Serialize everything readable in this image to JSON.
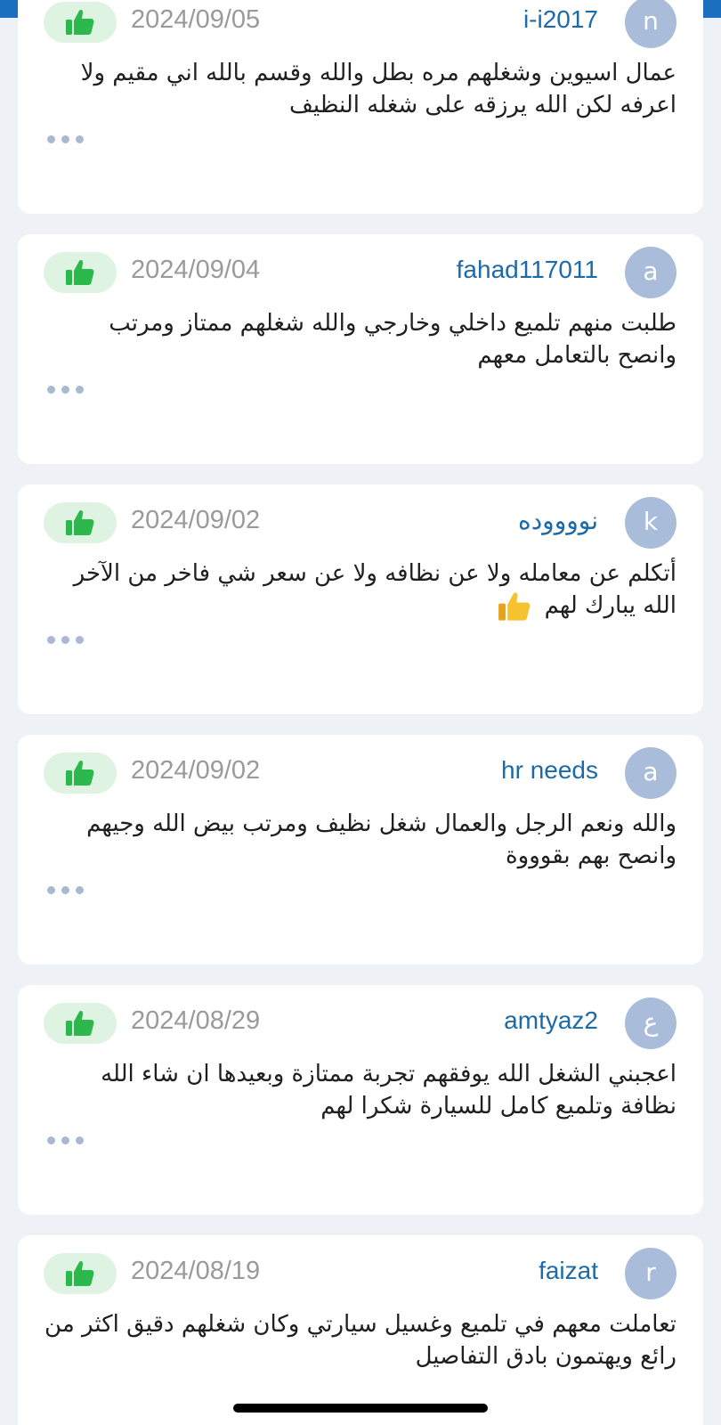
{
  "reviews": [
    {
      "avatar": "n",
      "username": "i-i2017",
      "date": "2024/09/05",
      "text": "عمال اسيوين وشغلهم مره بطل والله وقسم بالله اني مقيم ولا اعرفه لكن الله يرزقه على شغله النظيف"
    },
    {
      "avatar": "a",
      "username": "fahad117011",
      "date": "2024/09/04",
      "text": "طلبت منهم تلميع داخلي وخارجي  والله شغلهم ممتاز ومرتب وانصح بالتعامل معهم"
    },
    {
      "avatar": "k",
      "username": "نووووده",
      "date": "2024/09/02",
      "text": "أتكلم عن معامله ولا عن نظافه ولا عن سعر شي فاخر من الآخر الله يبارك لهم"
    },
    {
      "avatar": "a",
      "username": "hr needs",
      "date": "2024/09/02",
      "text": "والله ونعم الرجل والعمال شغل نظيف ومرتب بيض الله وجيهم وانصح بهم بقوووة"
    },
    {
      "avatar": "ع",
      "username": "amtyaz2",
      "date": "2024/08/29",
      "text": "اعجبني الشغل الله يوفقهم تجربة ممتازة وبعيدها ان شاء الله نظافة وتلميع كامل للسيارة شكرا لهم"
    },
    {
      "avatar": "r",
      "username": "faizat",
      "date": "2024/08/19",
      "text": "تعاملت معهم في تلميع  وغسيل  سيارتي  وكان شغلهم دقيق اكثر من رائع   ويهتمون  بادق التفاصيل"
    }
  ],
  "colors": {
    "accent": "#1a6fbe",
    "username": "#1d6aa8",
    "avatar_bg": "#a9bcd9",
    "like_bg": "#dff3e2",
    "like_icon": "#2db84d"
  },
  "icons": {
    "like": "thumbs-up-icon",
    "more": "more-dots-icon",
    "emoji": "thumbs-up-emoji-icon"
  }
}
